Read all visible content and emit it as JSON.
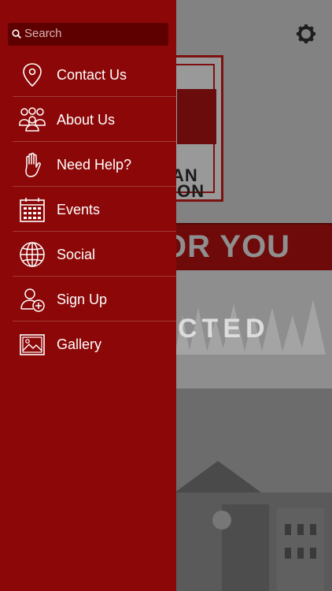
{
  "background": {
    "logo_text_line1": "AN",
    "logo_text_line2": "ION",
    "banner_text": "OR YOU",
    "section_text": "CTED",
    "settings_icon": "gear-icon"
  },
  "drawer": {
    "search": {
      "placeholder": "Search",
      "icon": "search-icon"
    },
    "items": [
      {
        "label": "Contact Us",
        "icon": "map-pin-icon"
      },
      {
        "label": "About Us",
        "icon": "people-icon"
      },
      {
        "label": "Need Help?",
        "icon": "hand-icon"
      },
      {
        "label": "Events",
        "icon": "calendar-icon"
      },
      {
        "label": "Social",
        "icon": "globe-icon"
      },
      {
        "label": "Sign Up",
        "icon": "add-user-icon"
      },
      {
        "label": "Gallery",
        "icon": "image-icon"
      }
    ]
  },
  "colors": {
    "drawer": "#8c0707",
    "search_field": "#5e0000",
    "banner": "#6e0a0a"
  }
}
